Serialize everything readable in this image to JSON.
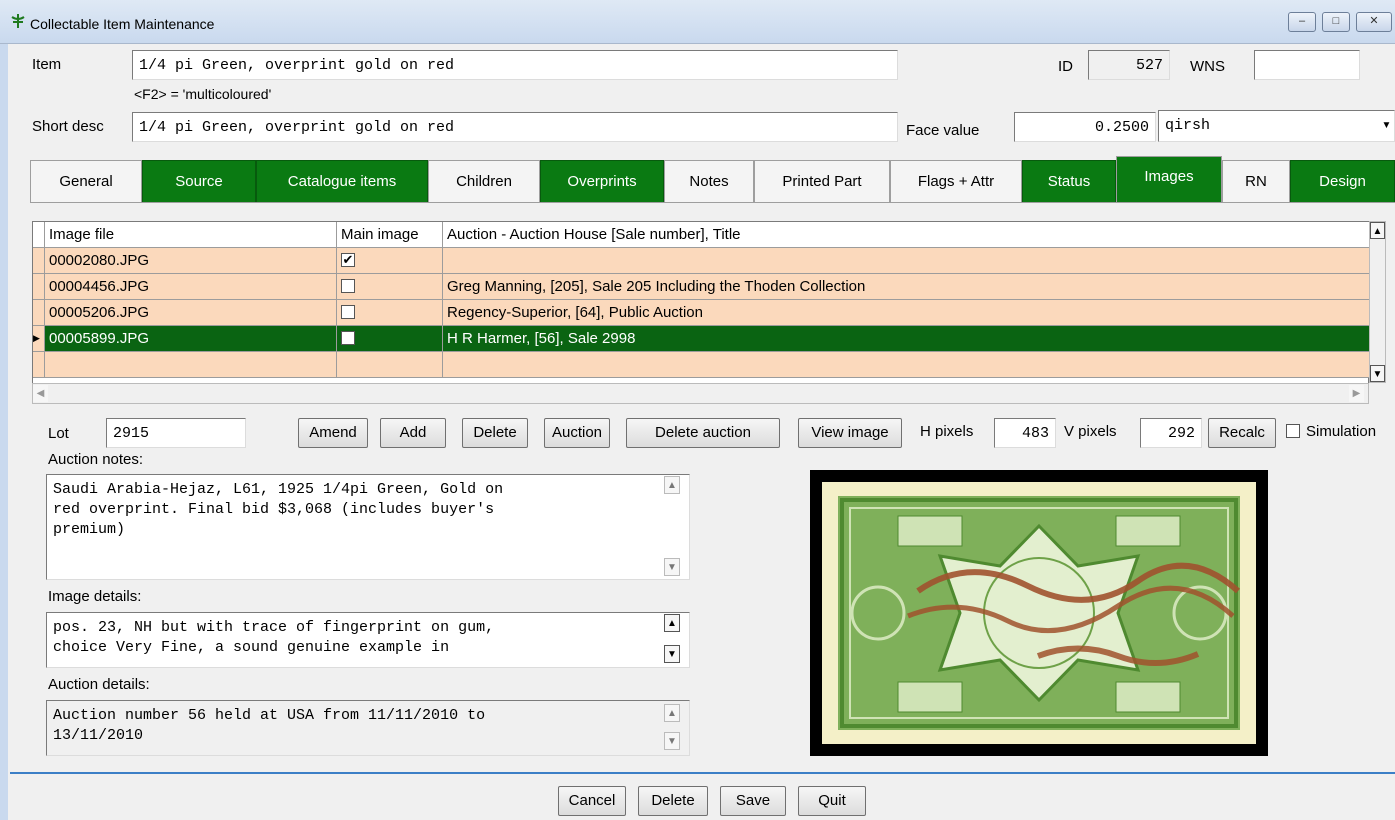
{
  "window": {
    "title": "Collectable Item Maintenance",
    "controls": [
      "minimize",
      "maximize",
      "close"
    ]
  },
  "item": {
    "label": "Item",
    "value": "1/4 pi Green, overprint gold on red",
    "hint": "<F2> = 'multicoloured'"
  },
  "id": {
    "label": "ID",
    "value": "527"
  },
  "wns": {
    "label": "WNS",
    "value": ""
  },
  "short_desc": {
    "label": "Short desc",
    "value": "1/4 pi Green, overprint gold on red"
  },
  "face_value": {
    "label": "Face value",
    "value": "0.2500",
    "unit": "qirsh"
  },
  "tabs": [
    {
      "label": "General",
      "style": "plain"
    },
    {
      "label": "Source",
      "style": "green"
    },
    {
      "label": "Catalogue items",
      "style": "green"
    },
    {
      "label": "Children",
      "style": "plain"
    },
    {
      "label": "Overprints",
      "style": "green"
    },
    {
      "label": "Notes",
      "style": "plain"
    },
    {
      "label": "Printed Part",
      "style": "plain"
    },
    {
      "label": "Flags + Attr",
      "style": "plain"
    },
    {
      "label": "Status",
      "style": "green"
    },
    {
      "label": "Images",
      "style": "active"
    },
    {
      "label": "RN",
      "style": "plain"
    },
    {
      "label": "Design",
      "style": "green"
    }
  ],
  "grid": {
    "columns": [
      "Image file",
      "Main image",
      "Auction - Auction House [Sale number], Title"
    ],
    "rows": [
      {
        "file": "00002080.JPG",
        "main": true,
        "auction": ""
      },
      {
        "file": "00004456.JPG",
        "main": false,
        "auction": "Greg Manning, [205], Sale 205 Including the Thoden Collection"
      },
      {
        "file": "00005206.JPG",
        "main": false,
        "auction": "Regency-Superior, [64], Public Auction"
      },
      {
        "file": "00005899.JPG",
        "main": false,
        "auction": "H R Harmer, [56], Sale 2998",
        "selected": true
      }
    ]
  },
  "lot": {
    "label": "Lot",
    "value": "2915"
  },
  "buttons": {
    "amend": "Amend",
    "add": "Add",
    "delete": "Delete",
    "auction": "Auction",
    "delete_auction": "Delete auction",
    "view_image": "View image",
    "recalc": "Recalc"
  },
  "pixels": {
    "h_label": "H pixels",
    "h_value": "483",
    "v_label": "V pixels",
    "v_value": "292"
  },
  "simulation": {
    "label": "Simulation",
    "checked": false
  },
  "auction_notes": {
    "label": "Auction notes:",
    "value": "Saudi Arabia-Hejaz, L61, 1925 1/4pi Green, Gold on\nred overprint. Final bid $3,068 (includes buyer's\npremium)"
  },
  "image_details": {
    "label": "Image details:",
    "value": "pos. 23, NH but with trace of fingerprint on gum,\nchoice Very Fine, a sound genuine example in"
  },
  "auction_details": {
    "label": "Auction details:",
    "value": "Auction number 56 held at USA from 11/11/2010 to\n13/11/2010"
  },
  "footer": {
    "cancel": "Cancel",
    "delete": "Delete",
    "save": "Save",
    "quit": "Quit"
  },
  "image": {
    "subject": "green stamp with red overprint",
    "colors": {
      "stamp": "#7fb05a",
      "overprint": "#a0522d",
      "paper": "#f4f0c8"
    }
  }
}
